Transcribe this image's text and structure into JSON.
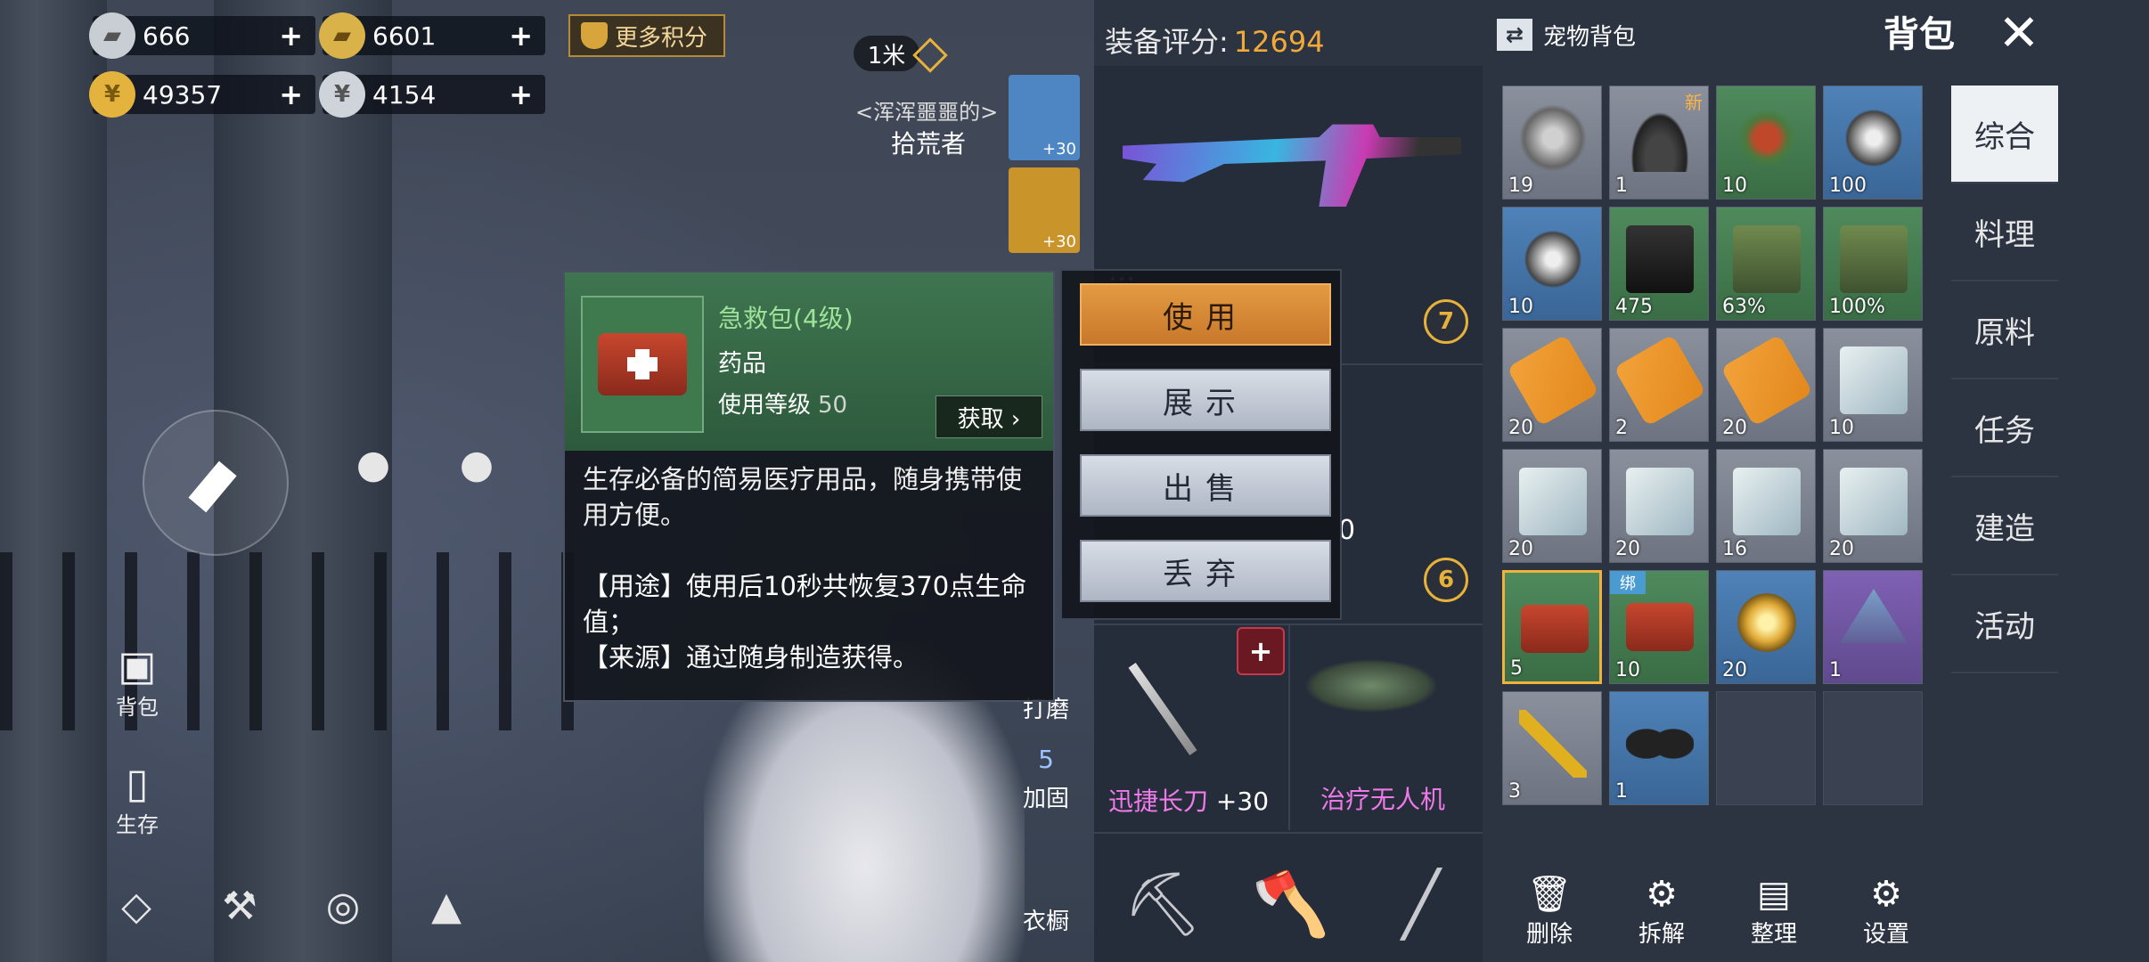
{
  "currencies": [
    {
      "icon": "silver-bar-icon",
      "value": "666"
    },
    {
      "icon": "gold-bar-icon",
      "value": "6601"
    },
    {
      "icon": "gold-coin-icon",
      "value": "49357"
    },
    {
      "icon": "silver-coin-icon",
      "value": "4154"
    }
  ],
  "currency_plus": "+",
  "more_points": "更多积分",
  "distance": "1米",
  "npc": {
    "name": "<浑浑噩噩的>",
    "title": "拾荒者"
  },
  "left_hud": {
    "backpack": "背包",
    "survive": "生存"
  },
  "side_strip": {
    "armor_level": "+30",
    "helmet_level": "+30",
    "polish": "打磨",
    "reinforce": "加固",
    "reinforce_count": "5",
    "wardrobe": "衣橱"
  },
  "tooltip": {
    "name": "急救包(4级)",
    "type": "药品",
    "level_label": "使用等级",
    "level_value": "50",
    "get_button": "获取 ›",
    "description": "生存必备的简易医疗用品，随身携带使用方便。",
    "usage": "【用途】使用后10秒共恢复370点生命值；",
    "source": "【来源】通过随身制造获得。"
  },
  "menu": {
    "use": "使用",
    "show": "展示",
    "sell": "出售",
    "discard": "丢弃"
  },
  "header": {
    "score_label": "装备评分:",
    "score_value": "12694",
    "pet_bag": "宠物背包",
    "bag_title": "背包",
    "close": "✕"
  },
  "equipment": {
    "gun_name_fragment": "…",
    "gun_level": "+30",
    "gun_badge": "7",
    "second_level": "0",
    "second_badge": "6",
    "melee_name": "迅捷长刀",
    "melee_level": "+30",
    "drone_name": "治疗无人机",
    "add_icon": "+"
  },
  "inventory": [
    {
      "art": "scrap",
      "rarity": "gray",
      "count": "19"
    },
    {
      "art": "pile",
      "rarity": "gray",
      "count": "1",
      "tag": "新"
    },
    {
      "art": "claw",
      "rarity": "green",
      "count": "10"
    },
    {
      "art": "fan",
      "rarity": "blue",
      "count": "100"
    },
    {
      "art": "fan",
      "rarity": "blue",
      "count": "10"
    },
    {
      "art": "battery",
      "rarity": "green",
      "count": "475"
    },
    {
      "art": "box",
      "rarity": "green",
      "count": "63%"
    },
    {
      "art": "box",
      "rarity": "green",
      "count": "100%"
    },
    {
      "art": "pill",
      "rarity": "gray",
      "count": "20"
    },
    {
      "art": "pill",
      "rarity": "gray",
      "count": "2"
    },
    {
      "art": "pill",
      "rarity": "gray",
      "count": "20"
    },
    {
      "art": "bandage",
      "rarity": "gray",
      "count": "10"
    },
    {
      "art": "bandage",
      "rarity": "gray",
      "count": "20"
    },
    {
      "art": "bandage",
      "rarity": "gray",
      "count": "20"
    },
    {
      "art": "bandage",
      "rarity": "gray",
      "count": "16"
    },
    {
      "art": "bandage",
      "rarity": "gray",
      "count": "20"
    },
    {
      "art": "med",
      "rarity": "green",
      "count": "5",
      "selected": true
    },
    {
      "art": "med",
      "rarity": "green",
      "count": "10",
      "tag_bind": "绑"
    },
    {
      "art": "gear",
      "rarity": "blue",
      "count": "20"
    },
    {
      "art": "tent",
      "rarity": "purple",
      "count": "1"
    },
    {
      "art": "screwdriver",
      "rarity": "gray",
      "count": "3"
    },
    {
      "art": "glasses",
      "rarity": "blue",
      "count": "1"
    },
    {
      "art": "",
      "rarity": "empty",
      "count": ""
    },
    {
      "art": "",
      "rarity": "empty",
      "count": ""
    }
  ],
  "tabs": [
    "综合",
    "料理",
    "原料",
    "任务",
    "建造",
    "活动"
  ],
  "actions": [
    {
      "icon": "trash-icon",
      "label": "删除"
    },
    {
      "icon": "dismantle-icon",
      "label": "拆解"
    },
    {
      "icon": "sort-icon",
      "label": "整理"
    },
    {
      "icon": "gear-icon",
      "label": "设置"
    }
  ],
  "colors": {
    "accent": "#f1a93a",
    "use_button": "#d98a34",
    "tab_active": "#eef1f4"
  }
}
